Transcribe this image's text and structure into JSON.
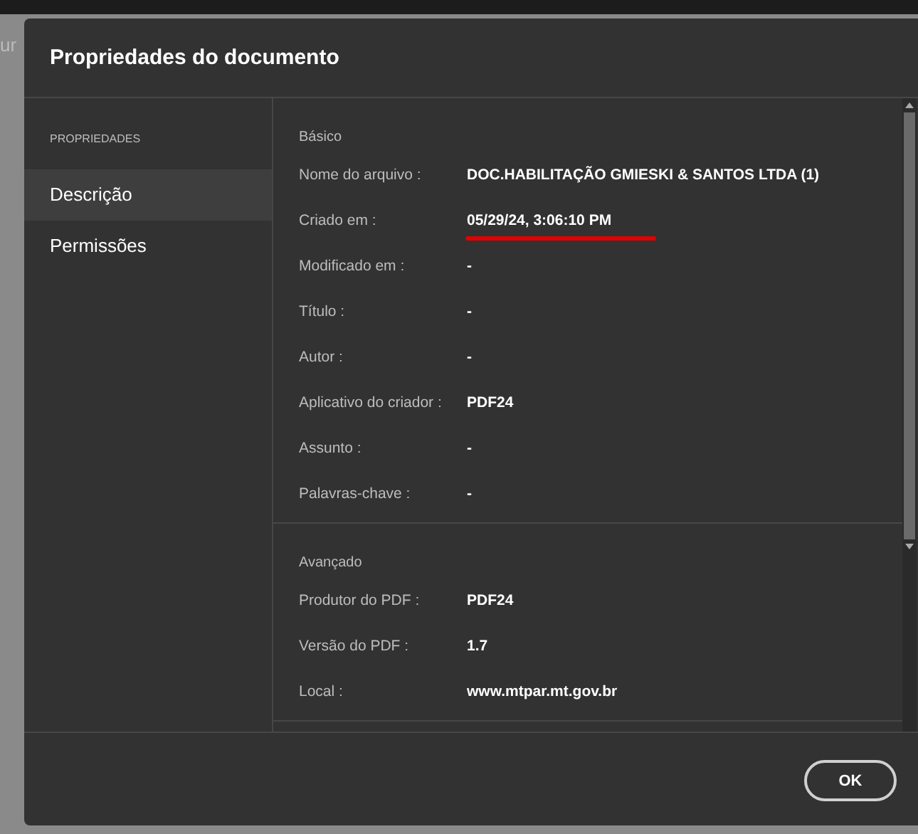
{
  "background": {
    "text_fragment": "ur"
  },
  "window": {
    "title": "Propriedades do documento"
  },
  "sidebar": {
    "heading": "PROPRIEDADES",
    "items": [
      {
        "label": "Descrição",
        "selected": true
      },
      {
        "label": "Permissões",
        "selected": false
      }
    ]
  },
  "sections": [
    {
      "title": "Básico",
      "rows": [
        {
          "label": "Nome do arquivo :",
          "value": "DOC.HABILITAÇÃO GMIESKI & SANTOS LTDA (1)",
          "underlined": false
        },
        {
          "label": "Criado em :",
          "value": "05/29/24, 3:06:10 PM",
          "underlined": true
        },
        {
          "label": "Modificado em :",
          "value": "-",
          "underlined": false
        },
        {
          "label": "Título :",
          "value": "-",
          "underlined": false
        },
        {
          "label": "Autor :",
          "value": "-",
          "underlined": false
        },
        {
          "label": "Aplicativo do criador :",
          "value": "PDF24",
          "underlined": false
        },
        {
          "label": "Assunto :",
          "value": "-",
          "underlined": false
        },
        {
          "label": "Palavras-chave :",
          "value": "-",
          "underlined": false
        }
      ]
    },
    {
      "title": "Avançado",
      "rows": [
        {
          "label": "Produtor do PDF :",
          "value": "PDF24",
          "underlined": false
        },
        {
          "label": "Versão do PDF :",
          "value": "1.7",
          "underlined": false
        },
        {
          "label": "Local :",
          "value": "www.mtpar.mt.gov.br",
          "underlined": false
        }
      ]
    }
  ],
  "buttons": [
    {
      "label": "OK"
    }
  ]
}
